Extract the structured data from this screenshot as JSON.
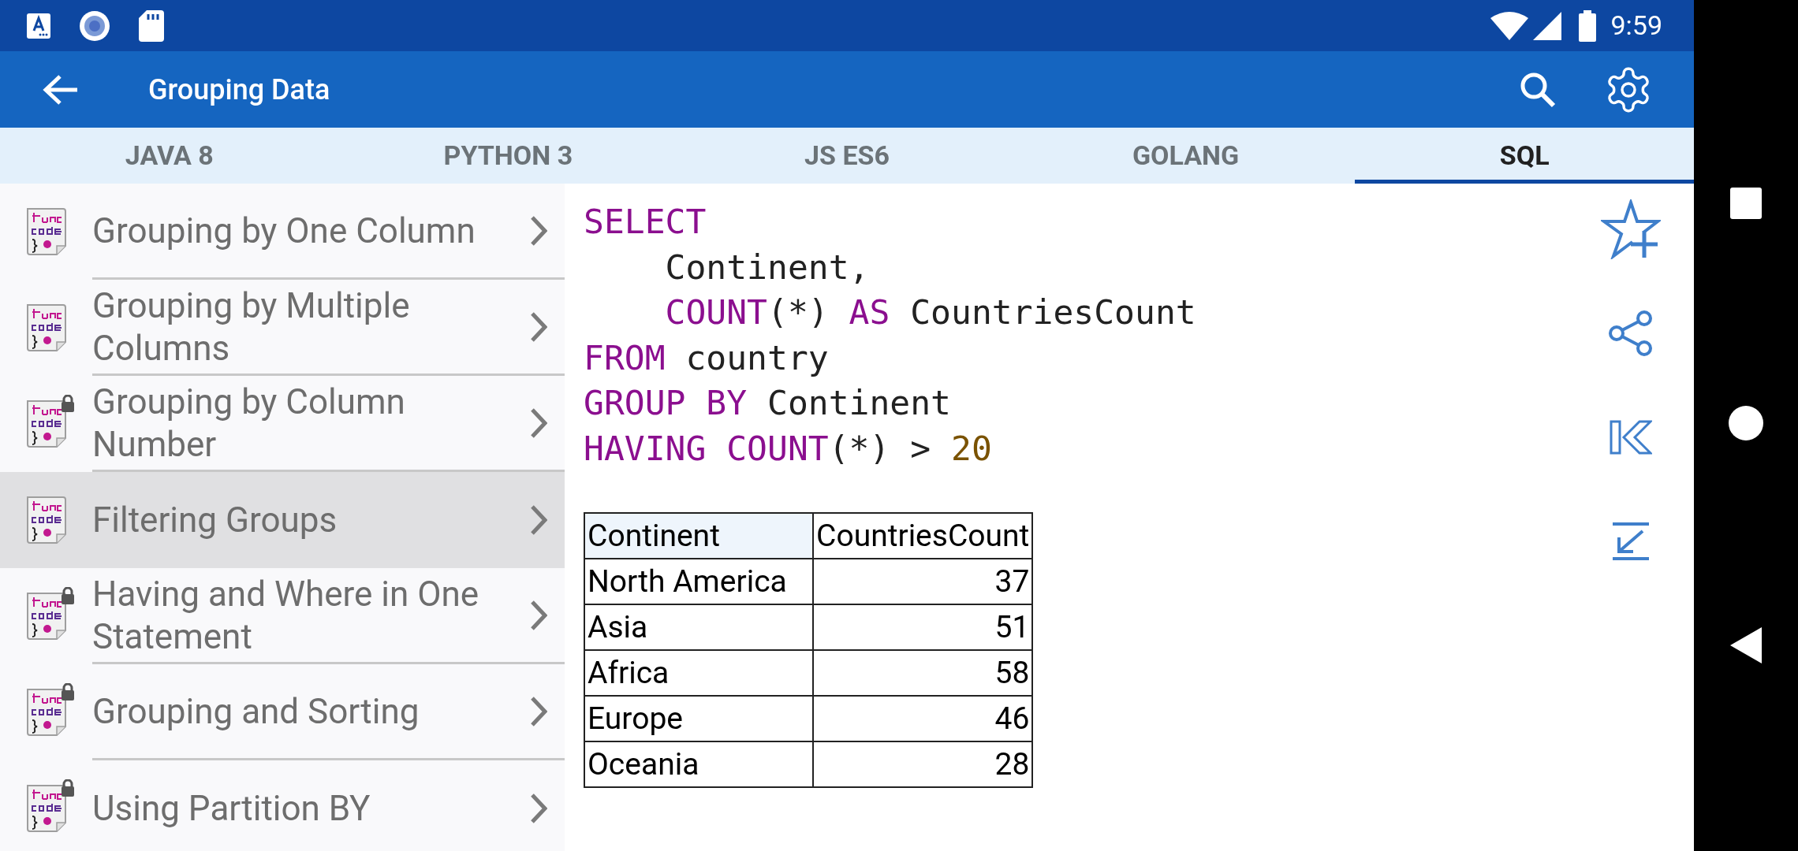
{
  "status_bar": {
    "time": "9:59"
  },
  "app_bar": {
    "title": "Grouping Data"
  },
  "tabs": [
    {
      "label": "JAVA 8",
      "selected": false
    },
    {
      "label": "PYTHON 3",
      "selected": false
    },
    {
      "label": "JS ES6",
      "selected": false
    },
    {
      "label": "GOLANG",
      "selected": false
    },
    {
      "label": "SQL",
      "selected": true
    }
  ],
  "topics": [
    {
      "label": "Grouping by One Column",
      "locked": false,
      "selected": false
    },
    {
      "label": "Grouping by Multiple Columns",
      "locked": false,
      "selected": false
    },
    {
      "label": "Grouping by Column Number",
      "locked": true,
      "selected": false
    },
    {
      "label": "Filtering Groups",
      "locked": false,
      "selected": true
    },
    {
      "label": "Having and Where in One Statement",
      "locked": true,
      "selected": false
    },
    {
      "label": "Grouping and Sorting",
      "locked": true,
      "selected": false
    },
    {
      "label": "Using Partition BY",
      "locked": true,
      "selected": false
    }
  ],
  "code": [
    {
      "indent": false,
      "tokens": [
        {
          "kind": "keyword",
          "text": "SELECT"
        }
      ]
    },
    {
      "indent": true,
      "tokens": [
        {
          "kind": "plain",
          "text": "Continent,"
        }
      ]
    },
    {
      "indent": true,
      "tokens": [
        {
          "kind": "keyword",
          "text": "COUNT"
        },
        {
          "kind": "plain",
          "text": "(*) "
        },
        {
          "kind": "keyword",
          "text": "AS"
        },
        {
          "kind": "plain",
          "text": " CountriesCount"
        }
      ]
    },
    {
      "indent": false,
      "tokens": [
        {
          "kind": "keyword",
          "text": "FROM"
        },
        {
          "kind": "plain",
          "text": " country"
        }
      ]
    },
    {
      "indent": false,
      "tokens": [
        {
          "kind": "keyword",
          "text": "GROUP BY"
        },
        {
          "kind": "plain",
          "text": " Continent"
        }
      ]
    },
    {
      "indent": false,
      "tokens": [
        {
          "kind": "keyword",
          "text": "HAVING COUNT"
        },
        {
          "kind": "plain",
          "text": "(*) > "
        },
        {
          "kind": "number",
          "text": "20"
        }
      ]
    }
  ],
  "result_table": {
    "columns": [
      "Continent",
      "CountriesCount"
    ],
    "rows": [
      [
        "North America",
        "37"
      ],
      [
        "Asia",
        "51"
      ],
      [
        "Africa",
        "58"
      ],
      [
        "Europe",
        "46"
      ],
      [
        "Oceania",
        "28"
      ]
    ]
  }
}
